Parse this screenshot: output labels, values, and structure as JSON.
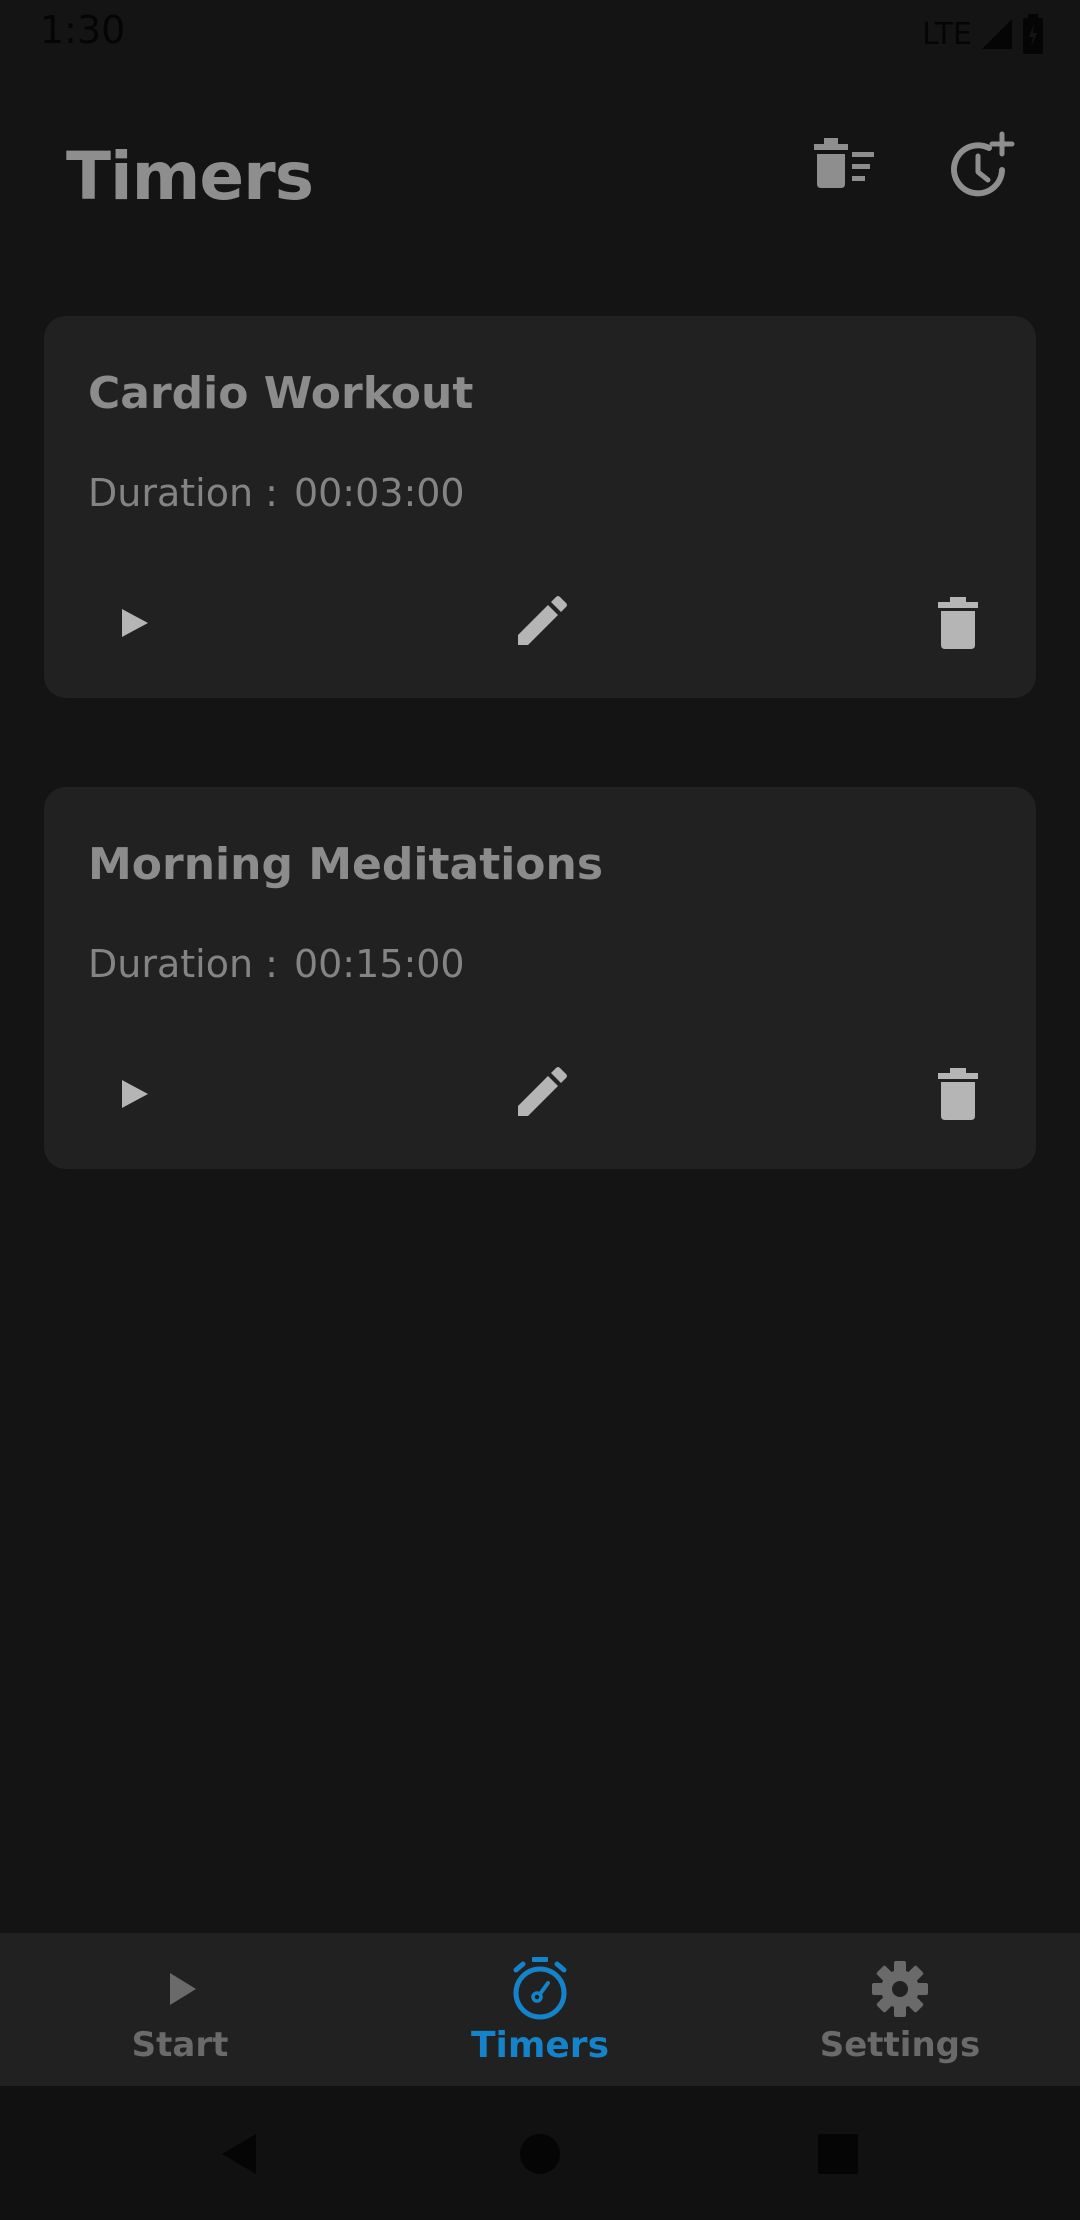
{
  "status_bar": {
    "time": "1:30",
    "network": "LTE"
  },
  "header": {
    "title": "Timers"
  },
  "timers": [
    {
      "name": "Cardio Workout",
      "duration_label": "Duration :",
      "duration": "00:03:00"
    },
    {
      "name": "Morning Meditations",
      "duration_label": "Duration :",
      "duration": "00:15:00"
    }
  ],
  "bottom_nav": {
    "items": [
      {
        "label": "Start",
        "icon": "play-icon"
      },
      {
        "label": "Timers",
        "icon": "stopwatch-icon",
        "active": true
      },
      {
        "label": "Settings",
        "icon": "gear-icon"
      }
    ]
  },
  "colors": {
    "background": "#141414",
    "card": "#212121",
    "text": "#8e8e8e",
    "accent": "#1583c9"
  }
}
